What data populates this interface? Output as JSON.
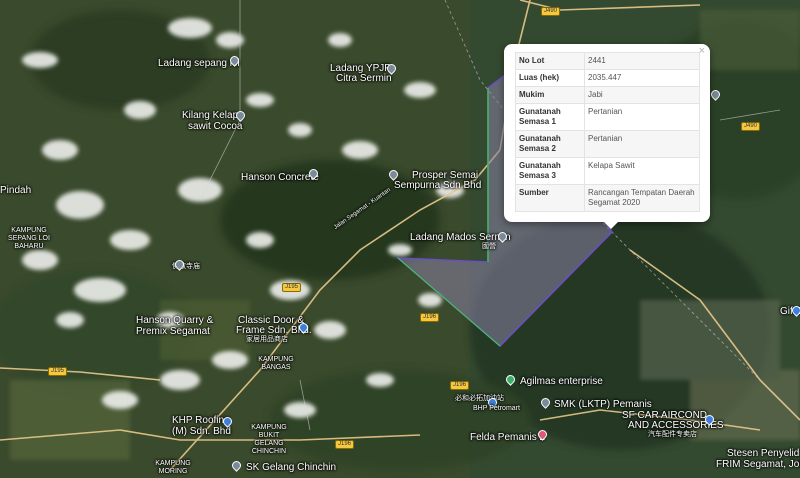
{
  "colors": {
    "parcel_fill": "#8a82a6",
    "parcel_stroke": "#6a4fc2",
    "parcel_edge": "#3fd14a",
    "road": "#e9c98a"
  },
  "popup": {
    "close_label": "×",
    "rows": [
      {
        "key": "No Lot",
        "value": "2441"
      },
      {
        "key": "Luas (hek)",
        "value": "2035.447"
      },
      {
        "key": "Mukim",
        "value": "Jabi"
      },
      {
        "key": "Gunatanah Semasa 1",
        "value": "Pertanian"
      },
      {
        "key": "Gunatanah Semasa 2",
        "value": "Pertanian"
      },
      {
        "key": "Gunatanah Semasa 3",
        "value": "Kelapa Sawit"
      },
      {
        "key": "Sumber",
        "value": "Rancangan Tempatan Daerah Segamat 2020"
      }
    ]
  },
  "places": {
    "ladang_sepang_loi": "Ladang sepang loi",
    "ladang_ypjp": "Ladang YPJP",
    "citra_sermin": "Citra Sermin",
    "kilang_kelapa": "Kilang Kelapa",
    "sawit_cocoa": "sawit Cocoa",
    "hanson_concrete": "Hanson Concrete",
    "prosper_semai": "Prosper Semai",
    "sempurna": "Sempurna Sdn Bhd",
    "pindah": "Pindah",
    "kampung_sepang": "KAMPUNG SEPANG LOI BAHARU",
    "ladang_mados": "Ladang Mados Sermin",
    "ladang_mados_cn": "國營",
    "hanson_quarry": "Hanson Quarry &",
    "premix": "Premix Segamat",
    "classic_door": "Classic Door &",
    "frame": "Frame Sdn. Bhd.",
    "frame_cn": "家居用品商店",
    "kampung_bangas": "KAMPUNG BANGAS",
    "khp_roofing": "KHP Roofing",
    "khp_roofing2": "(M) Sdn. Bhd",
    "kampung_bukit": "KAMPUNG BUKIT GELANG CHINCHIN",
    "kampung_moring": "KAMPUNG MORING",
    "sk_gelang": "SK Gelang Chinchin",
    "agilmas": "Agilmas enterprise",
    "petrol_cn": "必和必拓加油站",
    "bhp": "BHP Petromart",
    "smk": "SMK (LKTP) Pemanis",
    "felda": "Felda Pemanis 2",
    "sf_car": "SF CAR AIRCOND",
    "accessories": "AND ACCESSORIES",
    "sf_car_cn": "汽车配件专卖店",
    "stesen": "Stesen Penyelidikan",
    "frim": "FRIM Segamat, Johor",
    "gift": "Gift B",
    "jalan": "Jalan Segamat - Kuantan",
    "cn_temple": "佛教寺庙"
  },
  "shields": {
    "s1": "J490",
    "s2": "J490",
    "s3": "J195",
    "s4": "J195",
    "s5": "J196",
    "s6": "J196",
    "s7": "J196"
  }
}
